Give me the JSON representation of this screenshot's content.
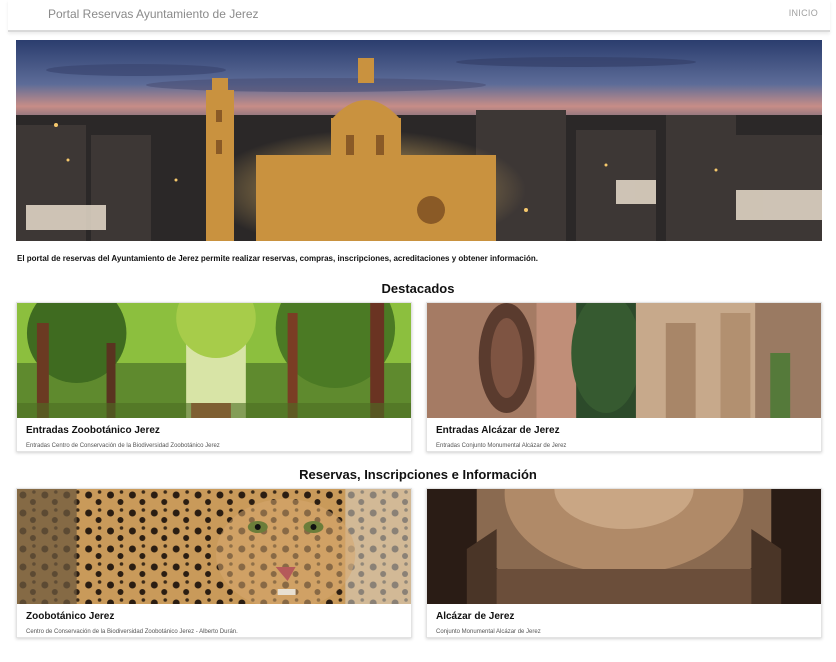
{
  "header": {
    "brand": "Portal Reservas Ayuntamiento de Jerez",
    "nav_inicio": "INICIO"
  },
  "intro": "El portal de reservas del Ayuntamiento de Jerez permite realizar reservas, compras, inscripciones, acreditaciones y obtener información.",
  "sections": [
    {
      "title": "Destacados",
      "cards": [
        {
          "title": "Entradas Zoobotánico Jerez",
          "subtitle": "Entradas Centro de Conservación de la Biodiversidad Zoobotánico Jerez"
        },
        {
          "title": "Entradas Alcázar de Jerez",
          "subtitle": "Entradas Conjunto Monumental Alcázar de Jerez"
        }
      ]
    },
    {
      "title": "Reservas, Inscripciones e Información",
      "cards": [
        {
          "title": "Zoobotánico Jerez",
          "subtitle": "Centro de Conservación de la Biodiversidad Zoobotánico Jerez - Alberto Durán."
        },
        {
          "title": "Alcázar de Jerez",
          "subtitle": "Conjunto Monumental Alcázar de Jerez"
        }
      ]
    }
  ]
}
